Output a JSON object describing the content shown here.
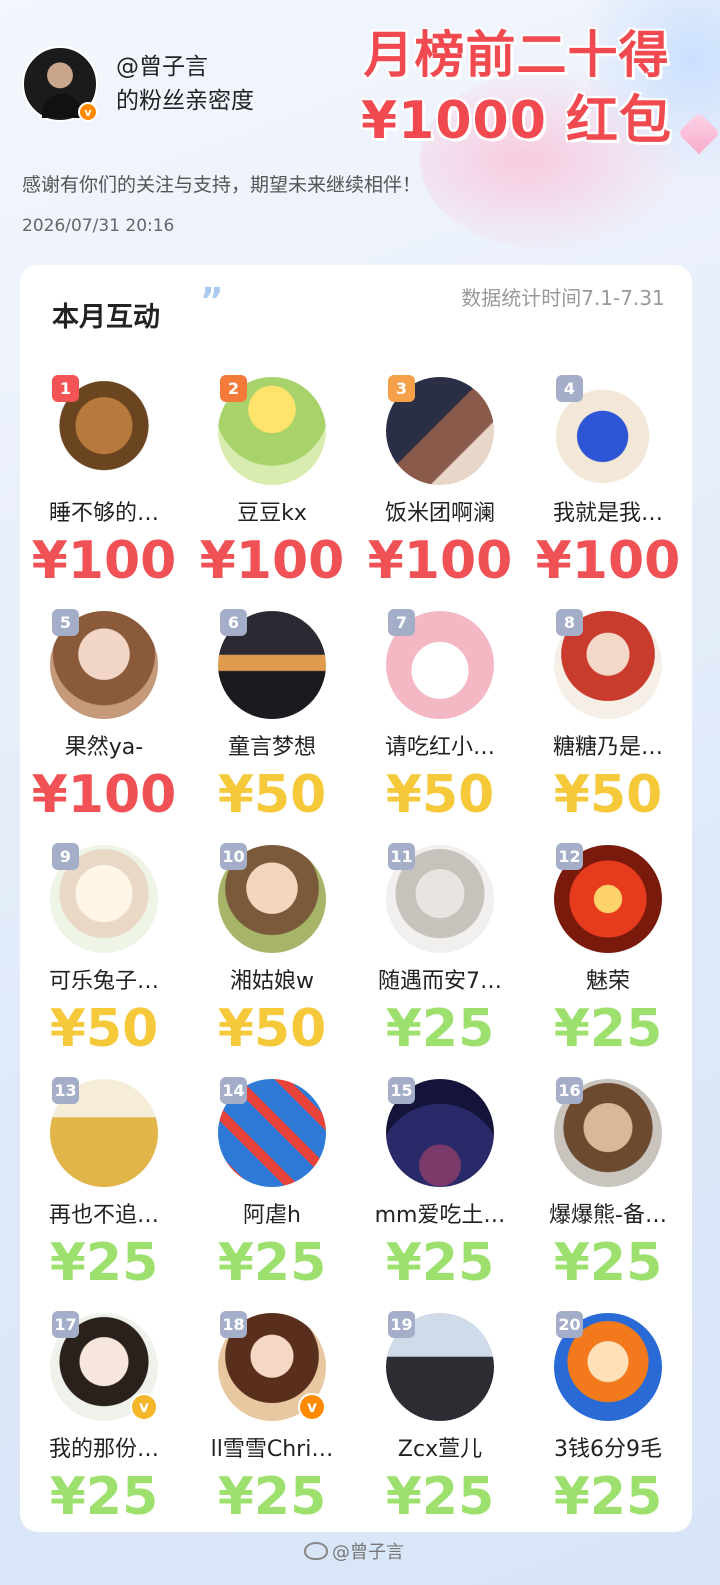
{
  "header": {
    "handle": "@曾子言",
    "subtitle": "的粉丝亲密度",
    "title_line1": "月榜前二十得",
    "title_line2": "¥1000 红包",
    "thanks": "感谢有你们的关注与支持，期望未来继续相伴！",
    "datetime": "2026/07/31  20:16"
  },
  "section": {
    "title": "本月互动",
    "quote": "”",
    "stat_time": "数据统计时间7.1-7.31"
  },
  "ranking": [
    {
      "rank": "1",
      "name": "睡不够的…",
      "amount": "¥100",
      "tier": "red"
    },
    {
      "rank": "2",
      "name": "豆豆kx",
      "amount": "¥100",
      "tier": "red"
    },
    {
      "rank": "3",
      "name": "饭米团啊澜",
      "amount": "¥100",
      "tier": "red"
    },
    {
      "rank": "4",
      "name": "我就是我…",
      "amount": "¥100",
      "tier": "red"
    },
    {
      "rank": "5",
      "name": "果然ya-",
      "amount": "¥100",
      "tier": "red"
    },
    {
      "rank": "6",
      "name": "童言梦想",
      "amount": "¥50",
      "tier": "yellow"
    },
    {
      "rank": "7",
      "name": "请吃红小…",
      "amount": "¥50",
      "tier": "yellow"
    },
    {
      "rank": "8",
      "name": "糖糖乃是…",
      "amount": "¥50",
      "tier": "yellow"
    },
    {
      "rank": "9",
      "name": "可乐兔子…",
      "amount": "¥50",
      "tier": "yellow"
    },
    {
      "rank": "10",
      "name": "湘姑娘w",
      "amount": "¥50",
      "tier": "yellow"
    },
    {
      "rank": "11",
      "name": "随遇而安7…",
      "amount": "¥25",
      "tier": "green"
    },
    {
      "rank": "12",
      "name": "魅荣",
      "amount": "¥25",
      "tier": "green"
    },
    {
      "rank": "13",
      "name": "再也不追…",
      "amount": "¥25",
      "tier": "green"
    },
    {
      "rank": "14",
      "name": "阿虐h",
      "amount": "¥25",
      "tier": "green"
    },
    {
      "rank": "15",
      "name": "mm爱吃土…",
      "amount": "¥25",
      "tier": "green"
    },
    {
      "rank": "16",
      "name": "爆爆熊-备…",
      "amount": "¥25",
      "tier": "green"
    },
    {
      "rank": "17",
      "name": "我的那份…",
      "amount": "¥25",
      "tier": "green"
    },
    {
      "rank": "18",
      "name": "ll雪雪Chri…",
      "amount": "¥25",
      "tier": "green"
    },
    {
      "rank": "19",
      "name": "Zcx萱儿",
      "amount": "¥25",
      "tier": "green"
    },
    {
      "rank": "20",
      "name": "3钱6分9毛",
      "amount": "¥25",
      "tier": "green"
    }
  ],
  "watermark": "@曾子言",
  "colors": {
    "title_red": "#f04a50",
    "tier_red": "#f05155",
    "tier_yellow": "#f5c93a",
    "tier_green": "#9de06e",
    "rank_gray": "#a5aec9"
  }
}
